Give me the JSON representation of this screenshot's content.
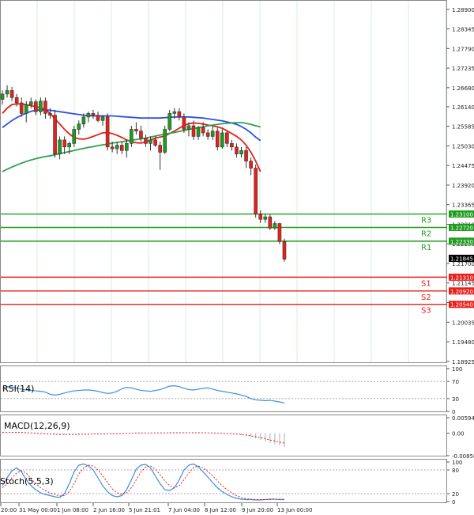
{
  "chart_data": {
    "type": "candlestick",
    "instrument_unit": "price",
    "x_labels": [
      "20:00",
      "31 May 00:00",
      "1 Jun 08:00",
      "2 Jun 16:00",
      "5 Jun 21:01",
      "7 Jun 04:00",
      "8 Jun 12:00",
      "9 Jun 20:00",
      "13 Jun 00:00"
    ],
    "price_ticks": [
      "1.28900",
      "1.28345",
      "1.27790",
      "1.27235",
      "1.26680",
      "1.26140",
      "1.25585",
      "1.25030",
      "1.24475",
      "1.23920",
      "1.23365",
      "1.22810",
      "1.22255",
      "1.21700",
      "1.21145",
      "1.20590",
      "1.20035",
      "1.19480",
      "1.18925"
    ],
    "price_range": [
      1.1892,
      1.2912
    ],
    "candles": [
      {
        "o": 1.2635,
        "h": 1.266,
        "l": 1.262,
        "c": 1.265
      },
      {
        "o": 1.265,
        "h": 1.2675,
        "l": 1.264,
        "c": 1.266
      },
      {
        "o": 1.266,
        "h": 1.267,
        "l": 1.263,
        "c": 1.264
      },
      {
        "o": 1.264,
        "h": 1.265,
        "l": 1.2615,
        "c": 1.2625
      },
      {
        "o": 1.2625,
        "h": 1.264,
        "l": 1.2585,
        "c": 1.2595
      },
      {
        "o": 1.2595,
        "h": 1.263,
        "l": 1.257,
        "c": 1.262
      },
      {
        "o": 1.262,
        "h": 1.264,
        "l": 1.261,
        "c": 1.2628
      },
      {
        "o": 1.2628,
        "h": 1.2635,
        "l": 1.259,
        "c": 1.26
      },
      {
        "o": 1.26,
        "h": 1.264,
        "l": 1.259,
        "c": 1.263
      },
      {
        "o": 1.263,
        "h": 1.264,
        "l": 1.258,
        "c": 1.2595
      },
      {
        "o": 1.2595,
        "h": 1.261,
        "l": 1.258,
        "c": 1.259
      },
      {
        "o": 1.259,
        "h": 1.2605,
        "l": 1.247,
        "c": 1.248
      },
      {
        "o": 1.248,
        "h": 1.253,
        "l": 1.2465,
        "c": 1.252
      },
      {
        "o": 1.252,
        "h": 1.253,
        "l": 1.248,
        "c": 1.25
      },
      {
        "o": 1.25,
        "h": 1.2515,
        "l": 1.248,
        "c": 1.251
      },
      {
        "o": 1.251,
        "h": 1.256,
        "l": 1.25,
        "c": 1.255
      },
      {
        "o": 1.255,
        "h": 1.2575,
        "l": 1.2535,
        "c": 1.2565
      },
      {
        "o": 1.2565,
        "h": 1.2595,
        "l": 1.2555,
        "c": 1.2585
      },
      {
        "o": 1.2585,
        "h": 1.26,
        "l": 1.257,
        "c": 1.2595
      },
      {
        "o": 1.2595,
        "h": 1.2605,
        "l": 1.258,
        "c": 1.259
      },
      {
        "o": 1.259,
        "h": 1.26,
        "l": 1.257,
        "c": 1.2575
      },
      {
        "o": 1.2575,
        "h": 1.259,
        "l": 1.256,
        "c": 1.2585
      },
      {
        "o": 1.2585,
        "h": 1.2595,
        "l": 1.249,
        "c": 1.25
      },
      {
        "o": 1.25,
        "h": 1.2515,
        "l": 1.2485,
        "c": 1.2495
      },
      {
        "o": 1.2495,
        "h": 1.2515,
        "l": 1.248,
        "c": 1.2505
      },
      {
        "o": 1.2505,
        "h": 1.2515,
        "l": 1.248,
        "c": 1.249
      },
      {
        "o": 1.249,
        "h": 1.252,
        "l": 1.247,
        "c": 1.251
      },
      {
        "o": 1.251,
        "h": 1.256,
        "l": 1.25,
        "c": 1.255
      },
      {
        "o": 1.255,
        "h": 1.257,
        "l": 1.2535,
        "c": 1.2545
      },
      {
        "o": 1.2545,
        "h": 1.256,
        "l": 1.2515,
        "c": 1.2525
      },
      {
        "o": 1.2525,
        "h": 1.2535,
        "l": 1.25,
        "c": 1.251
      },
      {
        "o": 1.251,
        "h": 1.253,
        "l": 1.249,
        "c": 1.252
      },
      {
        "o": 1.252,
        "h": 1.253,
        "l": 1.25,
        "c": 1.2505
      },
      {
        "o": 1.2505,
        "h": 1.2515,
        "l": 1.2435,
        "c": 1.2485
      },
      {
        "o": 1.2485,
        "h": 1.256,
        "l": 1.248,
        "c": 1.255
      },
      {
        "o": 1.255,
        "h": 1.2605,
        "l": 1.2545,
        "c": 1.2595
      },
      {
        "o": 1.2595,
        "h": 1.261,
        "l": 1.258,
        "c": 1.26
      },
      {
        "o": 1.26,
        "h": 1.261,
        "l": 1.2575,
        "c": 1.2585
      },
      {
        "o": 1.2585,
        "h": 1.2595,
        "l": 1.254,
        "c": 1.255
      },
      {
        "o": 1.255,
        "h": 1.257,
        "l": 1.253,
        "c": 1.256
      },
      {
        "o": 1.256,
        "h": 1.2575,
        "l": 1.252,
        "c": 1.253
      },
      {
        "o": 1.253,
        "h": 1.256,
        "l": 1.252,
        "c": 1.2555
      },
      {
        "o": 1.2555,
        "h": 1.257,
        "l": 1.253,
        "c": 1.254
      },
      {
        "o": 1.254,
        "h": 1.255,
        "l": 1.252,
        "c": 1.253
      },
      {
        "o": 1.253,
        "h": 1.256,
        "l": 1.252,
        "c": 1.2545
      },
      {
        "o": 1.2545,
        "h": 1.2555,
        "l": 1.249,
        "c": 1.25
      },
      {
        "o": 1.25,
        "h": 1.255,
        "l": 1.2495,
        "c": 1.254
      },
      {
        "o": 1.254,
        "h": 1.2545,
        "l": 1.25,
        "c": 1.251
      },
      {
        "o": 1.251,
        "h": 1.252,
        "l": 1.249,
        "c": 1.25
      },
      {
        "o": 1.25,
        "h": 1.251,
        "l": 1.247,
        "c": 1.248
      },
      {
        "o": 1.248,
        "h": 1.25,
        "l": 1.247,
        "c": 1.249
      },
      {
        "o": 1.249,
        "h": 1.25,
        "l": 1.244,
        "c": 1.246
      },
      {
        "o": 1.246,
        "h": 1.247,
        "l": 1.242,
        "c": 1.244
      },
      {
        "o": 1.244,
        "h": 1.245,
        "l": 1.23,
        "c": 1.231
      },
      {
        "o": 1.231,
        "h": 1.232,
        "l": 1.2285,
        "c": 1.2295
      },
      {
        "o": 1.2295,
        "h": 1.231,
        "l": 1.2285,
        "c": 1.2302
      },
      {
        "o": 1.2302,
        "h": 1.2308,
        "l": 1.2265,
        "c": 1.227
      },
      {
        "o": 1.227,
        "h": 1.229,
        "l": 1.2265,
        "c": 1.2283
      },
      {
        "o": 1.2283,
        "h": 1.2285,
        "l": 1.2225,
        "c": 1.2232
      },
      {
        "o": 1.2232,
        "h": 1.224,
        "l": 1.2175,
        "c": 1.2182
      }
    ],
    "moving_averages": [
      {
        "name": "",
        "color": "#e8201a",
        "values": [
          1.2595,
          1.261,
          1.262,
          1.2622,
          1.2622,
          1.262,
          1.2617,
          1.2614,
          1.2611,
          1.2605,
          1.2595,
          1.258,
          1.2565,
          1.255,
          1.2537,
          1.2527,
          1.2523,
          1.2522,
          1.2525,
          1.253,
          1.2535,
          1.254,
          1.2541,
          1.2538,
          1.2533,
          1.2527,
          1.252,
          1.2515,
          1.2512,
          1.2511,
          1.2514,
          1.252,
          1.2525,
          1.2528,
          1.2531,
          1.2538,
          1.2545,
          1.2553,
          1.2561,
          1.2566,
          1.2568,
          1.2567,
          1.2565,
          1.2562,
          1.256,
          1.2557,
          1.2553,
          1.2546,
          1.2538,
          1.253,
          1.252,
          1.2505,
          1.2485,
          1.246,
          1.243
        ]
      },
      {
        "name": "",
        "color": "#2b50e0",
        "values": [
          1.2555,
          1.2565,
          1.2575,
          1.2583,
          1.259,
          1.2596,
          1.2601,
          1.2604,
          1.2605,
          1.2605,
          1.2604,
          1.2602,
          1.26,
          1.2598,
          1.2596,
          1.2594,
          1.2592,
          1.259,
          1.2589,
          1.2588,
          1.2588,
          1.2588,
          1.2588,
          1.2588,
          1.2587,
          1.2586,
          1.2585,
          1.2584,
          1.2583,
          1.2582,
          1.2582,
          1.2582,
          1.2582,
          1.2582,
          1.2583,
          1.2584,
          1.2585,
          1.2585,
          1.2585,
          1.2585,
          1.2584,
          1.2583,
          1.2582,
          1.258,
          1.2578,
          1.2576,
          1.2574,
          1.2571,
          1.2568,
          1.2564,
          1.2558,
          1.255,
          1.254,
          1.2528,
          1.2518
        ]
      },
      {
        "name": "",
        "color": "#30a050",
        "values": [
          1.243,
          1.2437,
          1.2443,
          1.2449,
          1.2454,
          1.2459,
          1.2463,
          1.2467,
          1.247,
          1.2473,
          1.2475,
          1.2478,
          1.2481,
          1.2484,
          1.2487,
          1.249,
          1.2493,
          1.2496,
          1.2499,
          1.2501,
          1.2504,
          1.2506,
          1.2508,
          1.2511,
          1.2513,
          1.2515,
          1.2517,
          1.2519,
          1.2521,
          1.2523,
          1.2525,
          1.2528,
          1.2531,
          1.2534,
          1.2536,
          1.2539,
          1.2541,
          1.2544,
          1.2547,
          1.255,
          1.2552,
          1.2555,
          1.2557,
          1.256,
          1.2562,
          1.2564,
          1.2566,
          1.2567,
          1.2568,
          1.2569,
          1.2569,
          1.2567,
          1.2564,
          1.256,
          1.2557
        ]
      }
    ],
    "levels": [
      {
        "label": "R3",
        "value": 1.231,
        "value_text": "1.23100",
        "color": "#1f9c1f"
      },
      {
        "label": "R2",
        "value": 1.2272,
        "value_text": "1.22720",
        "color": "#1f9c1f"
      },
      {
        "label": "R1",
        "value": 1.2233,
        "value_text": "1.22330",
        "color": "#1f9c1f"
      },
      {
        "label": "S1",
        "value": 1.2131,
        "value_text": "1.21310",
        "color": "#e8201a"
      },
      {
        "label": "S2",
        "value": 1.2092,
        "value_text": "1.20920",
        "color": "#e8201a"
      },
      {
        "label": "S3",
        "value": 1.2054,
        "value_text": "1.20540",
        "color": "#e8201a"
      }
    ],
    "current_price": {
      "value": 1.21845,
      "text": "1.21845"
    },
    "colors": {
      "bull": "#1f9c1f",
      "bear": "#e8201a",
      "grid": "#d9eed9",
      "axis": "#555555"
    },
    "rsi": {
      "title": "RSI(14)",
      "ticks": [
        "100",
        "70",
        "30",
        "0"
      ],
      "range": [
        0,
        100
      ],
      "color": "#3a8fe0",
      "values": [
        55,
        58,
        57,
        54,
        52,
        50,
        49,
        48,
        47,
        45,
        40,
        38,
        40,
        43,
        46,
        48,
        49,
        50,
        50,
        49,
        47,
        44,
        42,
        43,
        47,
        53,
        56,
        55,
        52,
        49,
        48,
        47,
        49,
        51,
        55,
        59,
        60,
        58,
        54,
        51,
        50,
        52,
        54,
        55,
        52,
        49,
        47,
        45,
        43,
        41,
        38,
        35,
        30,
        27,
        26,
        25,
        26,
        24,
        22,
        20
      ]
    },
    "macd": {
      "title": "MACD(12,26,9)",
      "ticks": [
        "0.005941",
        "0.00",
        "-0.008589"
      ],
      "range": [
        -0.008589,
        0.005941
      ],
      "histogram": [
        0.0002,
        0.0003,
        0.0004,
        0.0004,
        0.0003,
        0.0002,
        0.0001,
        -0.0001,
        -0.0002,
        -0.0003,
        -0.0004,
        -0.0005,
        -0.0005,
        -0.0005,
        -0.0005,
        -0.0004,
        -0.0004,
        -0.0003,
        -0.0003,
        -0.0002,
        -0.0002,
        -0.0002,
        -0.0002,
        -0.0002,
        -0.0002,
        -0.0001,
        -0.0001,
        0.0001,
        0.0002,
        0.0002,
        0.0001,
        0.0001,
        0.0001,
        0.0001,
        0.0002,
        0.0003,
        0.0003,
        0.0003,
        0.0003,
        0.0002,
        0.0002,
        0.0002,
        0.0001,
        0.0001,
        0.0,
        -0.0001,
        -0.0001,
        -0.0002,
        -0.0003,
        -0.0005,
        -0.0007,
        -0.001,
        -0.0014,
        -0.002,
        -0.0025,
        -0.0031,
        -0.0037,
        -0.0042,
        -0.0047,
        -0.0052
      ],
      "signal": [
        0.0003,
        0.0003,
        0.0003,
        0.0003,
        0.0003,
        0.0002,
        0.0001,
        0.0,
        -0.0001,
        -0.0002,
        -0.0003,
        -0.0004,
        -0.0005,
        -0.0005,
        -0.0005,
        -0.0005,
        -0.0004,
        -0.0004,
        -0.0004,
        -0.0003,
        -0.0003,
        -0.0003,
        -0.0002,
        -0.0002,
        -0.0002,
        -0.0002,
        -0.0001,
        0.0,
        0.0001,
        0.0001,
        0.0001,
        0.0001,
        0.0001,
        0.0001,
        0.0001,
        0.0002,
        0.0002,
        0.0002,
        0.0002,
        0.0002,
        0.0002,
        0.0002,
        0.0002,
        0.0001,
        0.0001,
        0.0,
        0.0,
        -0.0001,
        -0.0002,
        -0.0003,
        -0.0005,
        -0.0007,
        -0.001,
        -0.0013,
        -0.0017,
        -0.0021,
        -0.0026,
        -0.003,
        -0.0034,
        -0.0038
      ]
    },
    "stoch": {
      "title": "Stoch(5,5,3)",
      "ticks": [
        "100",
        "80",
        "20",
        "0"
      ],
      "range": [
        0,
        100
      ],
      "main_color": "#3a8fe0",
      "signal_color": "#e8201a",
      "main": [
        40,
        60,
        78,
        85,
        75,
        55,
        40,
        30,
        22,
        18,
        15,
        12,
        10,
        20,
        45,
        75,
        92,
        95,
        90,
        80,
        60,
        40,
        25,
        15,
        12,
        15,
        30,
        55,
        82,
        92,
        94,
        85,
        65,
        45,
        30,
        28,
        35,
        55,
        80,
        92,
        95,
        88,
        75,
        62,
        48,
        35,
        25,
        18,
        12,
        8,
        6,
        5,
        5,
        4,
        4,
        5,
        6,
        6,
        5,
        5
      ],
      "signal": [
        35,
        45,
        60,
        72,
        78,
        72,
        58,
        45,
        35,
        27,
        22,
        18,
        14,
        15,
        25,
        45,
        70,
        85,
        92,
        90,
        80,
        65,
        48,
        32,
        22,
        18,
        22,
        35,
        55,
        75,
        88,
        90,
        82,
        68,
        52,
        40,
        35,
        40,
        55,
        72,
        86,
        90,
        85,
        76,
        65,
        52,
        40,
        30,
        22,
        15,
        10,
        7,
        6,
        5,
        5,
        5,
        5,
        6,
        6,
        6
      ]
    }
  }
}
